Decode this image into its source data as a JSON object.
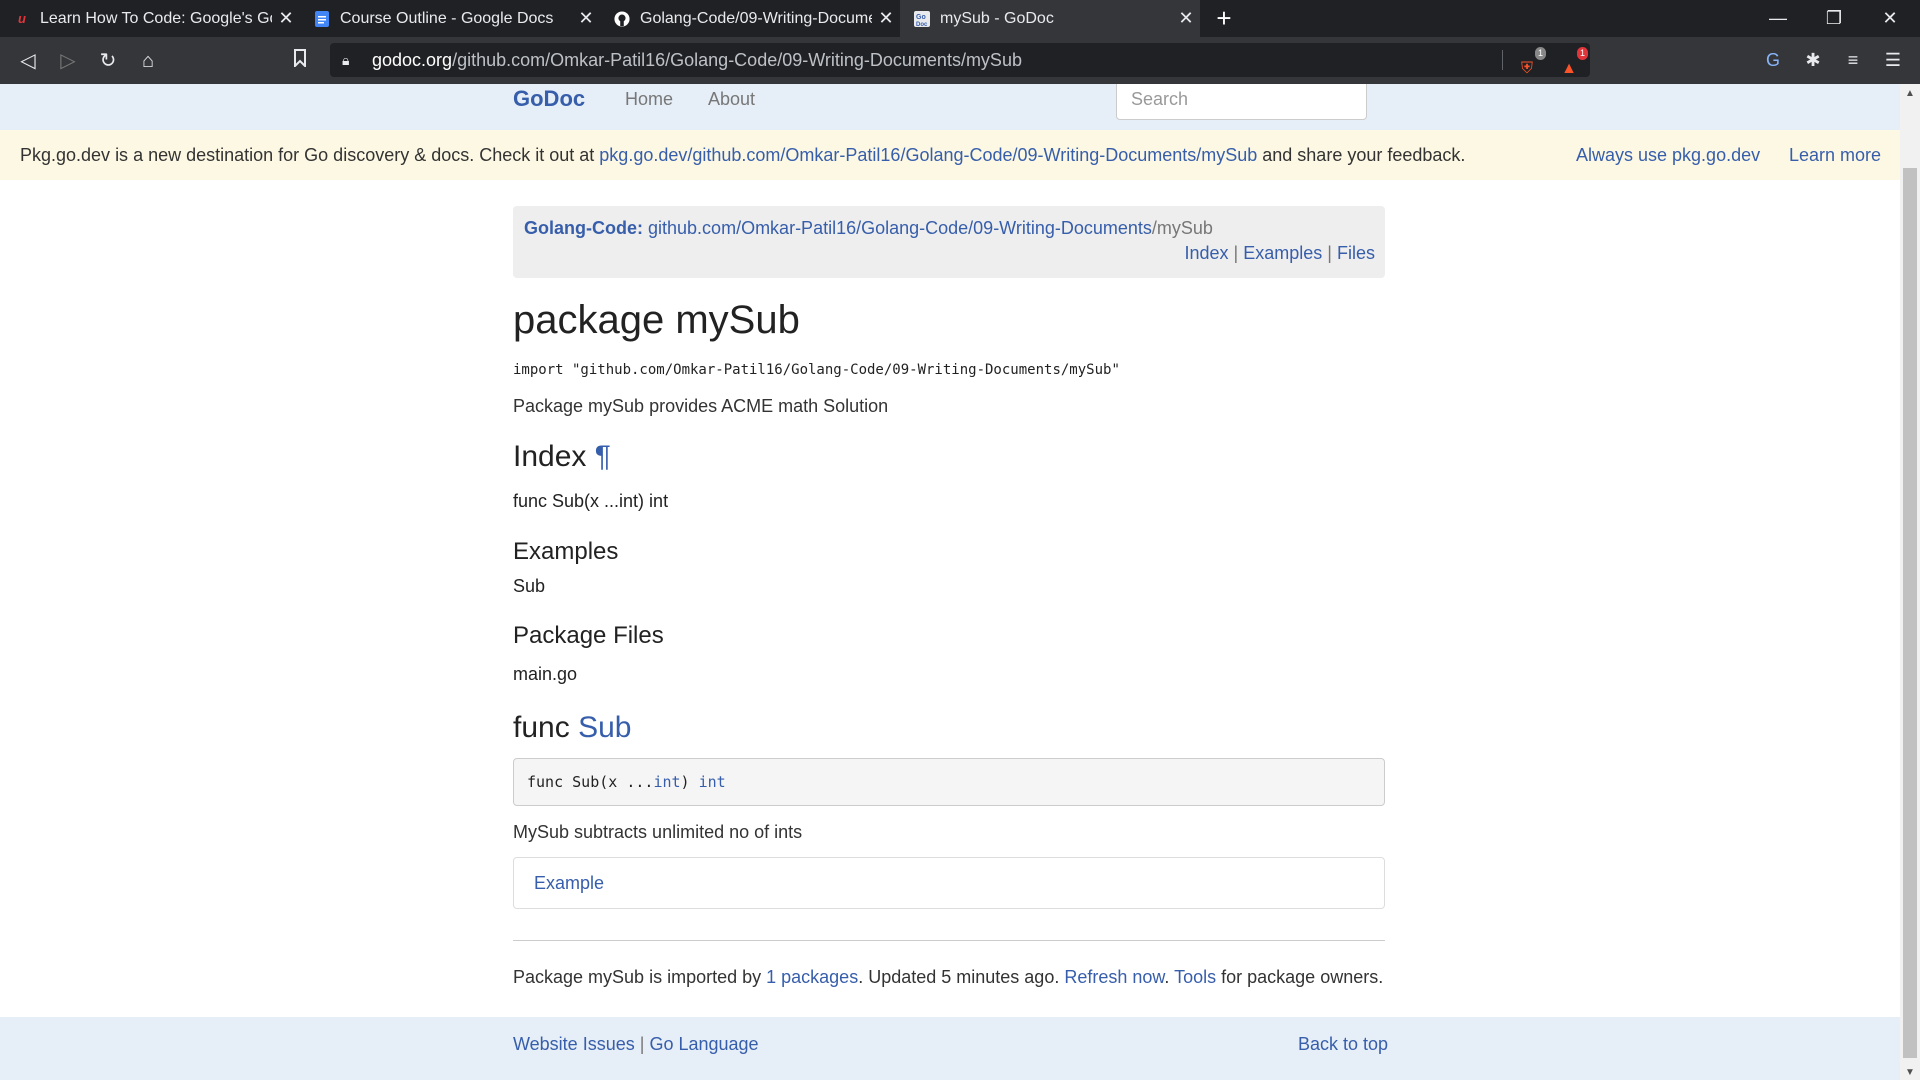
{
  "browser": {
    "tabs": [
      {
        "title": "Learn How To Code: Google's Go (",
        "icon": "udemy-icon"
      },
      {
        "title": "Course Outline - Google Docs",
        "icon": "google-docs-icon"
      },
      {
        "title": "Golang-Code/09-Writing-Docume",
        "icon": "github-icon"
      },
      {
        "title": "mySub - GoDoc",
        "icon": "godoc-icon"
      }
    ],
    "new_tab": "+",
    "url_domain": "godoc.org",
    "url_path": "/github.com/Omkar-Patil16/Golang-Code/09-Writing-Documents/mySub",
    "brave_shield_count": "1",
    "brave_rewards_count": "1"
  },
  "site": {
    "brand": "GoDoc",
    "nav": {
      "home": "Home",
      "about": "About"
    },
    "search_placeholder": "Search"
  },
  "banner": {
    "text_before": "Pkg.go.dev is a new destination for Go discovery & docs. Check it out at ",
    "link": "pkg.go.dev/github.com/Omkar-Patil16/Golang-Code/09-Writing-Documents/mySub",
    "text_after": " and share your feedback.",
    "always_use": "Always use pkg.go.dev",
    "learn_more": "Learn more"
  },
  "breadcrumb": {
    "project": "Golang-Code:",
    "path_link": "github.com/Omkar-Patil16/Golang-Code/09-Writing-Documents",
    "path_tail": "/mySub",
    "index": "Index",
    "examples": "Examples",
    "files": "Files",
    "sep": "|"
  },
  "package": {
    "title": "package mySub",
    "import": "import \"github.com/Omkar-Patil16/Golang-Code/09-Writing-Documents/mySub\"",
    "description": "Package mySub provides ACME math Solution"
  },
  "index": {
    "heading": "Index",
    "pilcrow": "¶",
    "func_link": "func Sub(x ...int) int",
    "examples_heading": "Examples",
    "example_link": "Sub",
    "files_heading": "Package Files",
    "file_link": "main.go"
  },
  "func": {
    "keyword": "func",
    "name": "Sub",
    "sig_prefix": "func Sub(x ...",
    "sig_type1": "int",
    "sig_mid": ") ",
    "sig_type2": "int",
    "doc": "MySub subtracts unlimited no of ints",
    "example_label": "Example"
  },
  "status": {
    "prefix": "Package mySub is imported by ",
    "imports_link": "1 packages",
    "mid": ". Updated 5 minutes ago. ",
    "refresh": "Refresh now",
    "dot": ". ",
    "tools": "Tools",
    "suffix": " for package owners."
  },
  "footer": {
    "issues": "Website Issues",
    "sep": "|",
    "golang": "Go Language",
    "back_to_top": "Back to top"
  }
}
